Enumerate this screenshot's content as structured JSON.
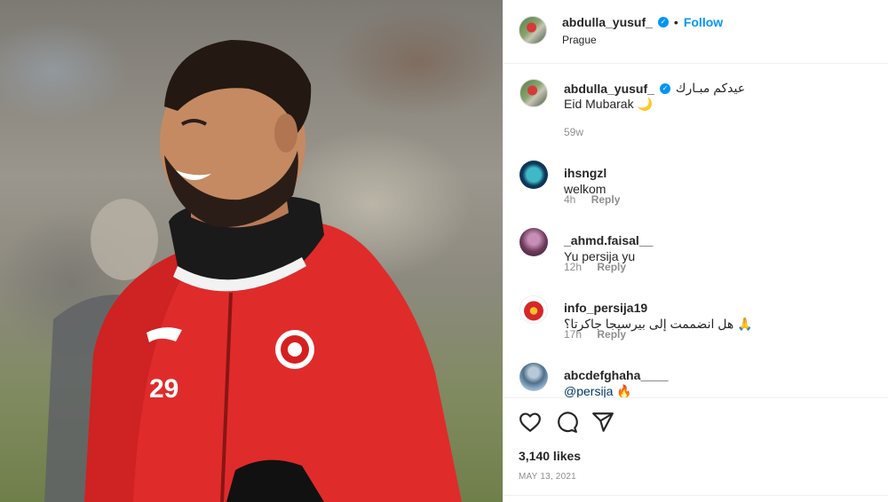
{
  "post": {
    "image_alt": "Smiling footballer in red training jacket with number 29",
    "jersey_number": "29",
    "brand_logo": "puma-logo",
    "club_crest": "slavia-praha-crest"
  },
  "header": {
    "username": "abdulla_yusuf_",
    "verified_icon": "verified-badge-icon",
    "separator": "•",
    "follow_label": "Follow",
    "location": "Prague"
  },
  "caption": {
    "username": "abdulla_yusuf_",
    "text_arabic": "عيدكم مبـارك",
    "text_english": "Eid Mubarak 🌙",
    "time": "59w"
  },
  "comments": [
    {
      "username": "ihsngzl",
      "text": "welkom",
      "time": "4h",
      "reply_label": "Reply"
    },
    {
      "username": "_ahmd.faisal__",
      "text": "Yu persija yu",
      "time": "12h",
      "reply_label": "Reply"
    },
    {
      "username": "info_persija19",
      "text": "هل انضممت إلى بيرسيجا جاكرتا؟ 🙏",
      "time": "17h",
      "reply_label": "Reply"
    },
    {
      "username": "abcdefghaha____",
      "text": "@persija 🔥",
      "time": "",
      "reply_label": ""
    }
  ],
  "actions": {
    "like_icon": "heart-icon",
    "comment_icon": "comment-bubble-icon",
    "share_icon": "paper-plane-icon",
    "likes": "3,140 likes",
    "date": "MAY 13, 2021"
  },
  "colors": {
    "accent": "#0095f6",
    "text": "#262626",
    "muted": "#8e8e8e",
    "jacket": "#e02b2b"
  }
}
